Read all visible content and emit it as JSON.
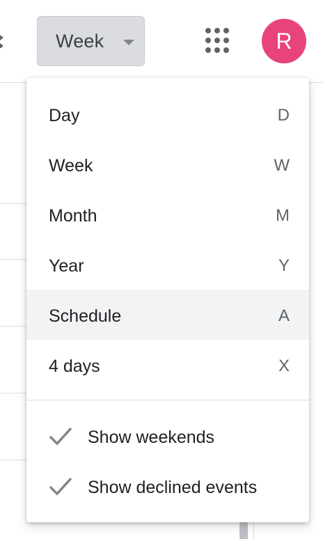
{
  "header": {
    "view_select_label": "Week",
    "avatar_letter": "R",
    "avatar_color": "#e8437b"
  },
  "menu": {
    "items": [
      {
        "label": "Day",
        "shortcut": "D"
      },
      {
        "label": "Week",
        "shortcut": "W"
      },
      {
        "label": "Month",
        "shortcut": "M"
      },
      {
        "label": "Year",
        "shortcut": "Y"
      },
      {
        "label": "Schedule",
        "shortcut": "A"
      },
      {
        "label": "4 days",
        "shortcut": "X"
      }
    ],
    "toggles": [
      {
        "label": "Show weekends",
        "checked": true
      },
      {
        "label": "Show declined events",
        "checked": true
      }
    ]
  }
}
